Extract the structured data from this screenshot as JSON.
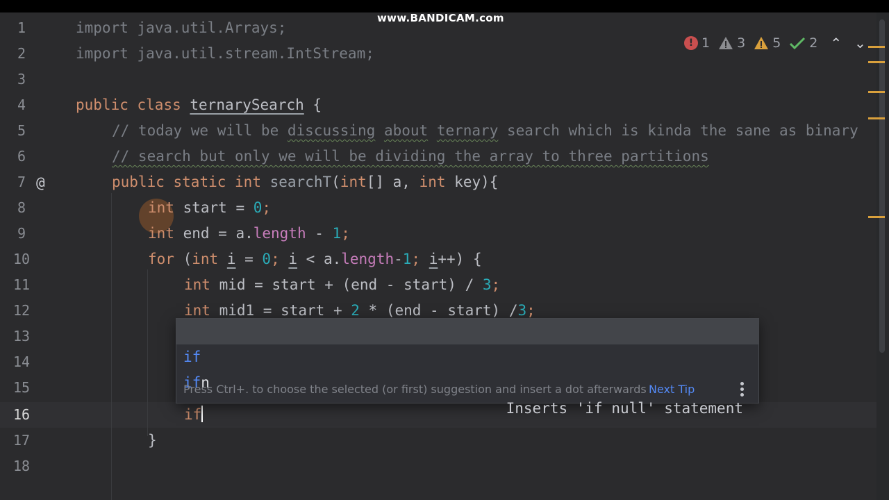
{
  "watermark": "www.BANDICAM.com",
  "inspections": {
    "errors": "1",
    "warnings": "3",
    "weak_warnings": "5",
    "typos": "2"
  },
  "gutter": {
    "lines": [
      "1",
      "2",
      "3",
      "4",
      "5",
      "6",
      "7",
      "8",
      "9",
      "10",
      "11",
      "12",
      "13",
      "14",
      "15",
      "16",
      "17",
      "18"
    ],
    "annotation_marker": "@"
  },
  "code": {
    "l1": "import java.util.Arrays;",
    "l2": "import java.util.stream.IntStream;",
    "l4": {
      "kw1": "public",
      "kw2": "class",
      "name": "ternarySearch",
      "brace": "{"
    },
    "l5": {
      "a": "// today we will be ",
      "b": "discussing",
      "c": " ",
      "d": "about",
      "e": " ",
      "f": "ternary",
      "g": " search which is kinda the sane as binary"
    },
    "l6": {
      "a": "// search but only we will be dividing the array to three partitions"
    },
    "l7": {
      "kw1": "public",
      "kw2": "static",
      "kw3": "int",
      "fn": "searchT",
      "p1": "(",
      "kw4": "int",
      "p2": "[] a, ",
      "kw5": "int",
      "p3": " key){"
    },
    "l8": {
      "kw": "int",
      "a": " start = ",
      "num": "0",
      "b": ";"
    },
    "l9": {
      "kw": "int",
      "a": " end = a.",
      "fld": "length",
      "b": " - ",
      "num": "1",
      "c": ";"
    },
    "l10": {
      "kw1": "for",
      "a": " (",
      "kw2": "int",
      "b": " ",
      "i1": "i",
      "c": " = ",
      "n1": "0",
      "d": "; ",
      "i2": "i",
      "e": " < a.",
      "fld": "length",
      "f": "-",
      "n2": "1",
      "g": "; ",
      "i3": "i",
      "h": "++) {"
    },
    "l11": {
      "kw": "int",
      "a": " mid = start + (end - start) / ",
      "num": "3",
      "b": ";"
    },
    "l12": {
      "kw": "int",
      "a": " mid1 = start + ",
      "n1": "2",
      "b": " * (end - start) /",
      "n2": "3",
      "c": ";"
    },
    "l16": "if",
    "l17": "}"
  },
  "completion": {
    "items": [
      {
        "prefix": "if",
        "rest": "",
        "description": ""
      },
      {
        "prefix": "if",
        "rest": "n",
        "description": "Inserts 'if null' statement"
      }
    ],
    "hint": "Press Ctrl+. to choose the selected (or first) suggestion and insert a dot afterwards",
    "next_tip": "Next Tip"
  },
  "colors": {
    "background": "#2b2b2d",
    "keyword": "#cf8e6d",
    "comment": "#7a7e85",
    "number": "#2aacb8",
    "field": "#c77dbb",
    "link": "#548af7",
    "error": "#c94f4f",
    "warning": "#d9a03c",
    "ok": "#5fb865"
  }
}
